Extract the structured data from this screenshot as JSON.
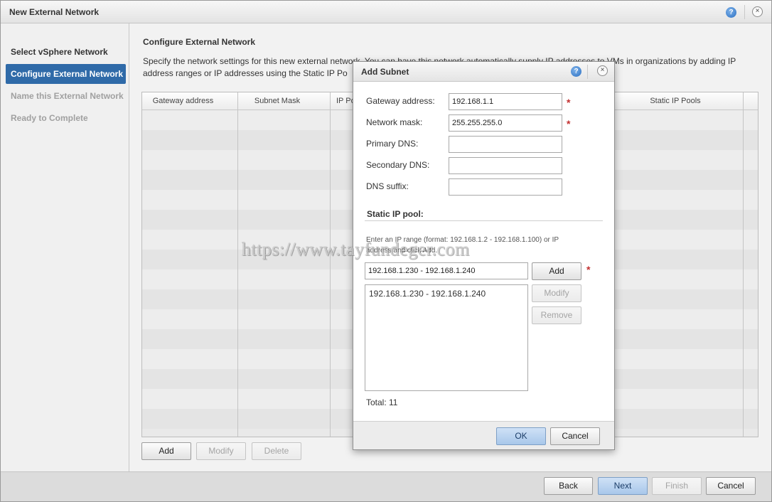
{
  "window": {
    "title": "New External Network"
  },
  "sidebar": {
    "steps": [
      {
        "label": "Select vSphere Network",
        "state": "done"
      },
      {
        "label": "Configure External Network",
        "state": "active"
      },
      {
        "label": "Name this External Network",
        "state": "pending"
      },
      {
        "label": "Ready to Complete",
        "state": "pending"
      }
    ]
  },
  "main": {
    "heading": "Configure External Network",
    "description": "Specify the network settings for this new external network. You can have this network automatically supply IP addresses to VMs in organizations by adding IP address ranges or IP addresses using the Static IP Po",
    "grid": {
      "columns": [
        "Gateway address",
        "Subnet Mask",
        "IP Po",
        "Static IP Pools"
      ]
    },
    "buttons": {
      "add": "Add",
      "modify": "Modify",
      "delete": "Delete"
    }
  },
  "footer": {
    "back": "Back",
    "next": "Next",
    "finish": "Finish",
    "cancel": "Cancel"
  },
  "dialog": {
    "title": "Add Subnet",
    "fields": {
      "gateway": {
        "label": "Gateway address:",
        "value": "192.168.1.1"
      },
      "mask": {
        "label": "Network mask:",
        "value": "255.255.255.0"
      },
      "dns1": {
        "label": "Primary DNS:",
        "value": ""
      },
      "dns2": {
        "label": "Secondary DNS:",
        "value": ""
      },
      "suffix": {
        "label": "DNS suffix:",
        "value": ""
      }
    },
    "required_mark": "*",
    "pool": {
      "title": "Static IP pool:",
      "hint": "Enter an IP range (format: 192.168.1.2 - 192.168.1.100) or IP address and click Add.",
      "input_value": "192.168.1.230 - 192.168.1.240",
      "add": "Add",
      "modify": "Modify",
      "remove": "Remove",
      "ranges": [
        "192.168.1.230 - 192.168.1.240"
      ],
      "total": "Total: 11"
    },
    "ok": "OK",
    "cancel": "Cancel"
  },
  "watermark": "https://www.tayfundeger.com",
  "icons": {
    "help": "?",
    "close": "×"
  },
  "colors": {
    "active_step": "#2f6aa8",
    "required": "#c23030",
    "primary_button": "#a8c7ea"
  }
}
